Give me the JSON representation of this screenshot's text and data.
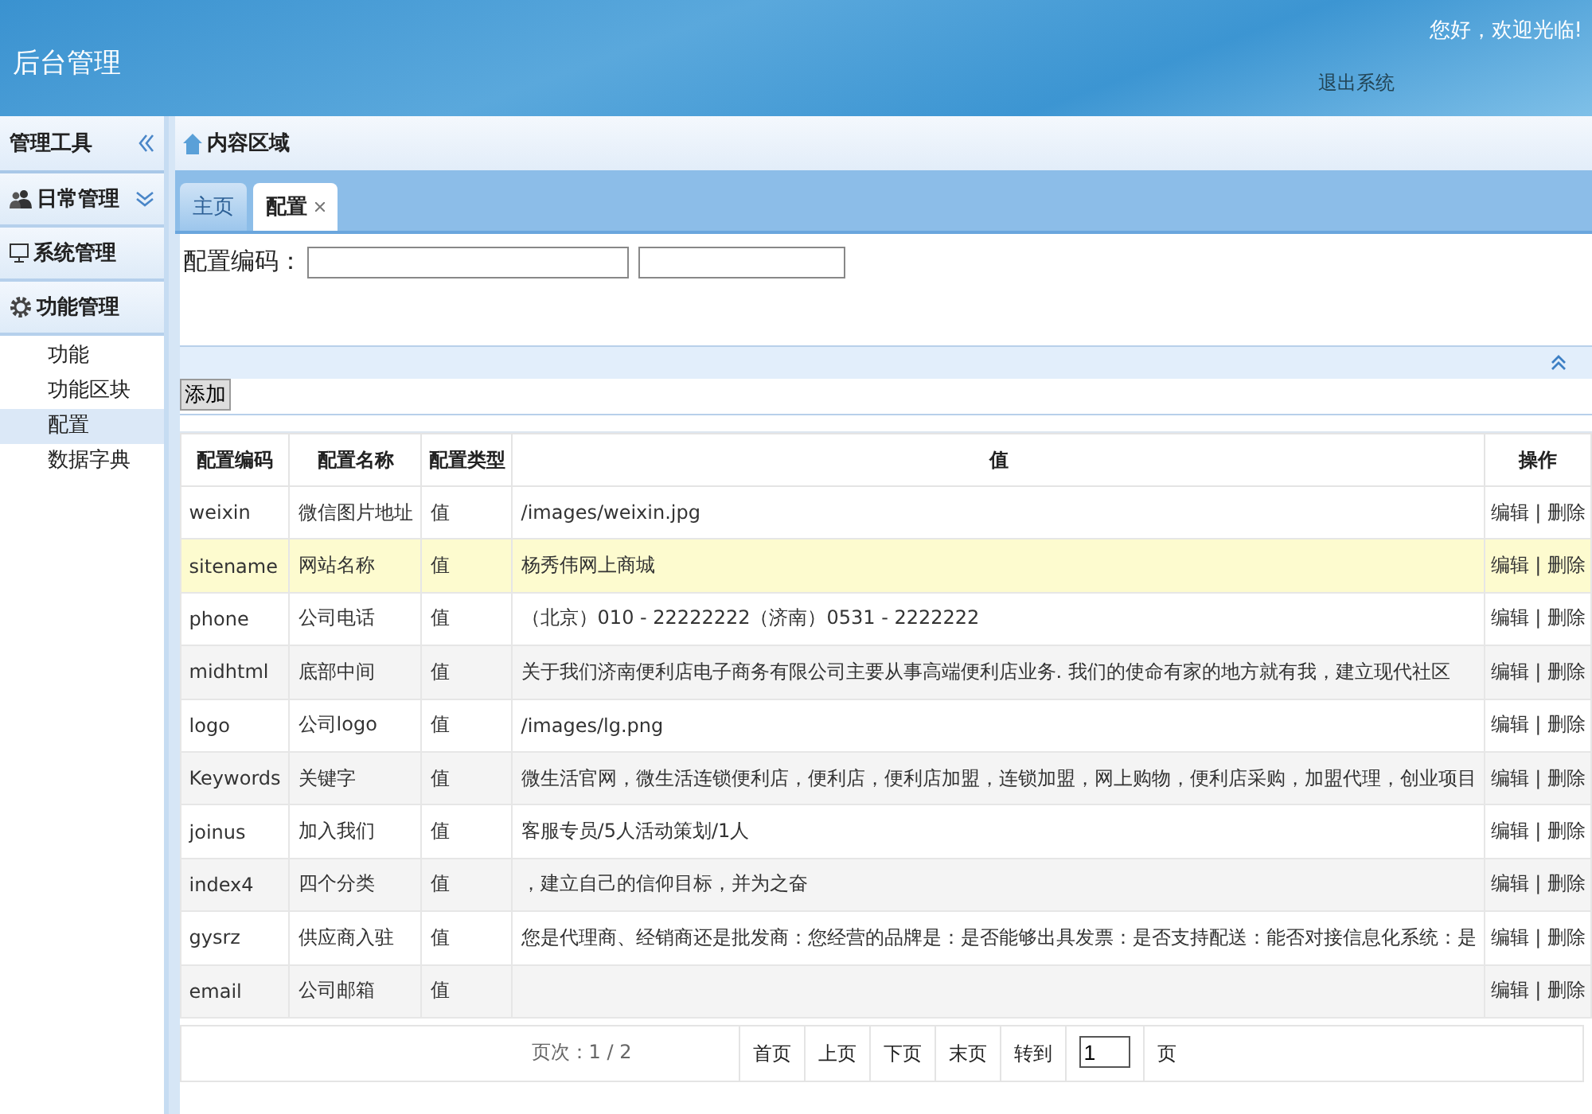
{
  "header": {
    "title": "后台管理",
    "greeting": "您好，欢迎光临!",
    "logout": "退出系统"
  },
  "sidebar": {
    "title": "管理工具",
    "groups": [
      {
        "label": "日常管理"
      },
      {
        "label": "系统管理"
      },
      {
        "label": "功能管理",
        "children": [
          {
            "label": "功能",
            "selected": false
          },
          {
            "label": "功能区块",
            "selected": false
          },
          {
            "label": "配置",
            "selected": true
          },
          {
            "label": "数据字典",
            "selected": false
          }
        ]
      }
    ]
  },
  "content": {
    "title": "内容区域",
    "tabs": [
      {
        "label": "主页",
        "selected": false,
        "closable": false
      },
      {
        "label": "配置",
        "selected": true,
        "closable": true
      }
    ],
    "search": {
      "label": "配置编码："
    },
    "add_button": "添加",
    "table": {
      "columns": [
        "配置编码",
        "配置名称",
        "配置类型",
        "值",
        "操作"
      ],
      "rows": [
        {
          "code": "weixin",
          "name": "微信图片地址",
          "type": "值",
          "value": "/images/weixin.jpg",
          "selected": false,
          "edit": "编辑",
          "separator": "|",
          "delete": "删除"
        },
        {
          "code": "sitename",
          "name": "网站名称",
          "type": "值",
          "value": "杨秀伟网上商城",
          "selected": true,
          "edit": "编辑",
          "separator": "|",
          "delete": "删除"
        },
        {
          "code": "phone",
          "name": "公司电话",
          "type": "值",
          "value": "（北京）010 - 22222222（济南）0531 - 2222222",
          "selected": false,
          "edit": "编辑",
          "separator": "|",
          "delete": "删除"
        },
        {
          "code": "midhtml",
          "name": "底部中间",
          "type": "值",
          "value": "关于我们济南便利店电子商务有限公司主要从事高端便利店业务. 我们的使命有家的地方就有我，建立现代社区",
          "selected": false,
          "edit": "编辑",
          "separator": "|",
          "delete": "删除"
        },
        {
          "code": "logo",
          "name": "公司logo",
          "type": "值",
          "value": "/images/lg.png",
          "selected": false,
          "edit": "编辑",
          "separator": "|",
          "delete": "删除"
        },
        {
          "code": "Keywords",
          "name": "关键字",
          "type": "值",
          "value": "微生活官网，微生活连锁便利店，便利店，便利店加盟，连锁加盟，网上购物，便利店采购，加盟代理，创业项目",
          "selected": false,
          "edit": "编辑",
          "separator": "|",
          "delete": "删除"
        },
        {
          "code": "joinus",
          "name": "加入我们",
          "type": "值",
          "value": "客服专员/5人活动策划/1人",
          "selected": false,
          "edit": "编辑",
          "separator": "|",
          "delete": "删除"
        },
        {
          "code": "index4",
          "name": "四个分类",
          "type": "值",
          "value": "，建立自己的信仰目标，并为之奋",
          "selected": false,
          "edit": "编辑",
          "separator": "|",
          "delete": "删除"
        },
        {
          "code": "gysrz",
          "name": "供应商入驻",
          "type": "值",
          "value": "您是代理商、经销商还是批发商：您经营的品牌是：是否能够出具发票：是否支持配送：能否对接信息化系统：是",
          "selected": false,
          "edit": "编辑",
          "separator": "|",
          "delete": "删除"
        },
        {
          "code": "email",
          "name": "公司邮箱",
          "type": "值",
          "selected": false,
          "edit": "编辑",
          "separator": "|",
          "delete": "删除"
        }
      ]
    },
    "pager": {
      "info": "页次：1 / 2",
      "buttons": [
        "首页",
        "上页",
        "下页",
        "末页"
      ],
      "goto": "转到",
      "page_value": "1",
      "unit": "页"
    }
  }
}
